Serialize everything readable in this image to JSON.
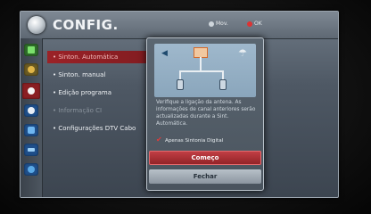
{
  "window": {
    "title": "CONFIG.",
    "hints": {
      "move": "Mov.",
      "ok": "OK"
    }
  },
  "sidebar": {
    "icons": [
      {
        "name": "picture-icon",
        "color": "#49a33b"
      },
      {
        "name": "audio-icon",
        "color": "#d49e2a"
      },
      {
        "name": "setup-icon",
        "color": "#c72a30",
        "active": true
      },
      {
        "name": "time-icon",
        "color": "#2a7bd4"
      },
      {
        "name": "lock-icon",
        "color": "#2a7bd4"
      },
      {
        "name": "option-icon",
        "color": "#2a7bd4"
      },
      {
        "name": "network-icon",
        "color": "#2a7bd4"
      }
    ]
  },
  "menu": {
    "items": [
      {
        "label": "• Sinton. Automática",
        "state": "selected"
      },
      {
        "label": "• Sinton. manual",
        "state": "normal"
      },
      {
        "label": "• Edição programa",
        "state": "normal"
      },
      {
        "label": "• Informação CI",
        "state": "disabled"
      },
      {
        "label": "• Configurações DTV Cabo",
        "state": "normal"
      }
    ]
  },
  "popup": {
    "message": "Verifique a ligação da antena. As informações de canal anteriores serão actualizadas durante a Sint. Automática.",
    "checkbox_label": "Apenas Sintonia Digital",
    "checkbox_checked": true,
    "start_button": "Começo",
    "close_button": "Fechar"
  }
}
